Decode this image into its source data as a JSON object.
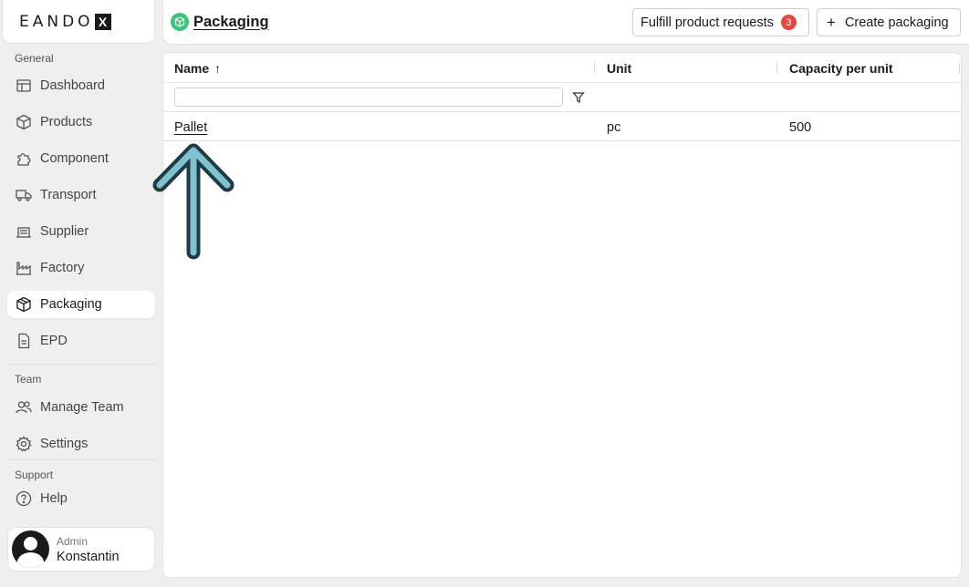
{
  "logo": {
    "text": "EANDO",
    "mark": "X"
  },
  "sidebar": {
    "sections": {
      "general": "General",
      "team": "Team",
      "support": "Support"
    },
    "items": [
      {
        "label": "Dashboard",
        "icon": "layout-icon"
      },
      {
        "label": "Products",
        "icon": "cube-icon"
      },
      {
        "label": "Component",
        "icon": "puzzle-icon"
      },
      {
        "label": "Transport",
        "icon": "truck-icon"
      },
      {
        "label": "Supplier",
        "icon": "warehouse-icon"
      },
      {
        "label": "Factory",
        "icon": "factory-icon"
      },
      {
        "label": "Packaging",
        "icon": "package-icon",
        "active": true
      },
      {
        "label": "EPD",
        "icon": "document-icon"
      },
      {
        "label": "Manage Team",
        "icon": "users-icon"
      },
      {
        "label": "Settings",
        "icon": "gear-icon"
      },
      {
        "label": "Help",
        "icon": "help-circle-icon"
      }
    ],
    "user": {
      "role": "Admin",
      "name": "Konstantin"
    }
  },
  "header": {
    "title": "Packaging",
    "fulfill_button": "Fulfill product requests",
    "fulfill_badge": "3",
    "create_button": "Create packaging",
    "create_icon": "+"
  },
  "table": {
    "columns": [
      "Name",
      "Unit",
      "Capacity per unit"
    ],
    "sort_indicator": "↑",
    "filter_value": "",
    "rows": [
      {
        "name": "Pallet",
        "unit": "pc",
        "capacity": "500"
      }
    ]
  },
  "colors": {
    "accent_green": "#3ec47a",
    "badge_red": "#e8453c",
    "annotation_arrow": "#7fc3d0"
  }
}
